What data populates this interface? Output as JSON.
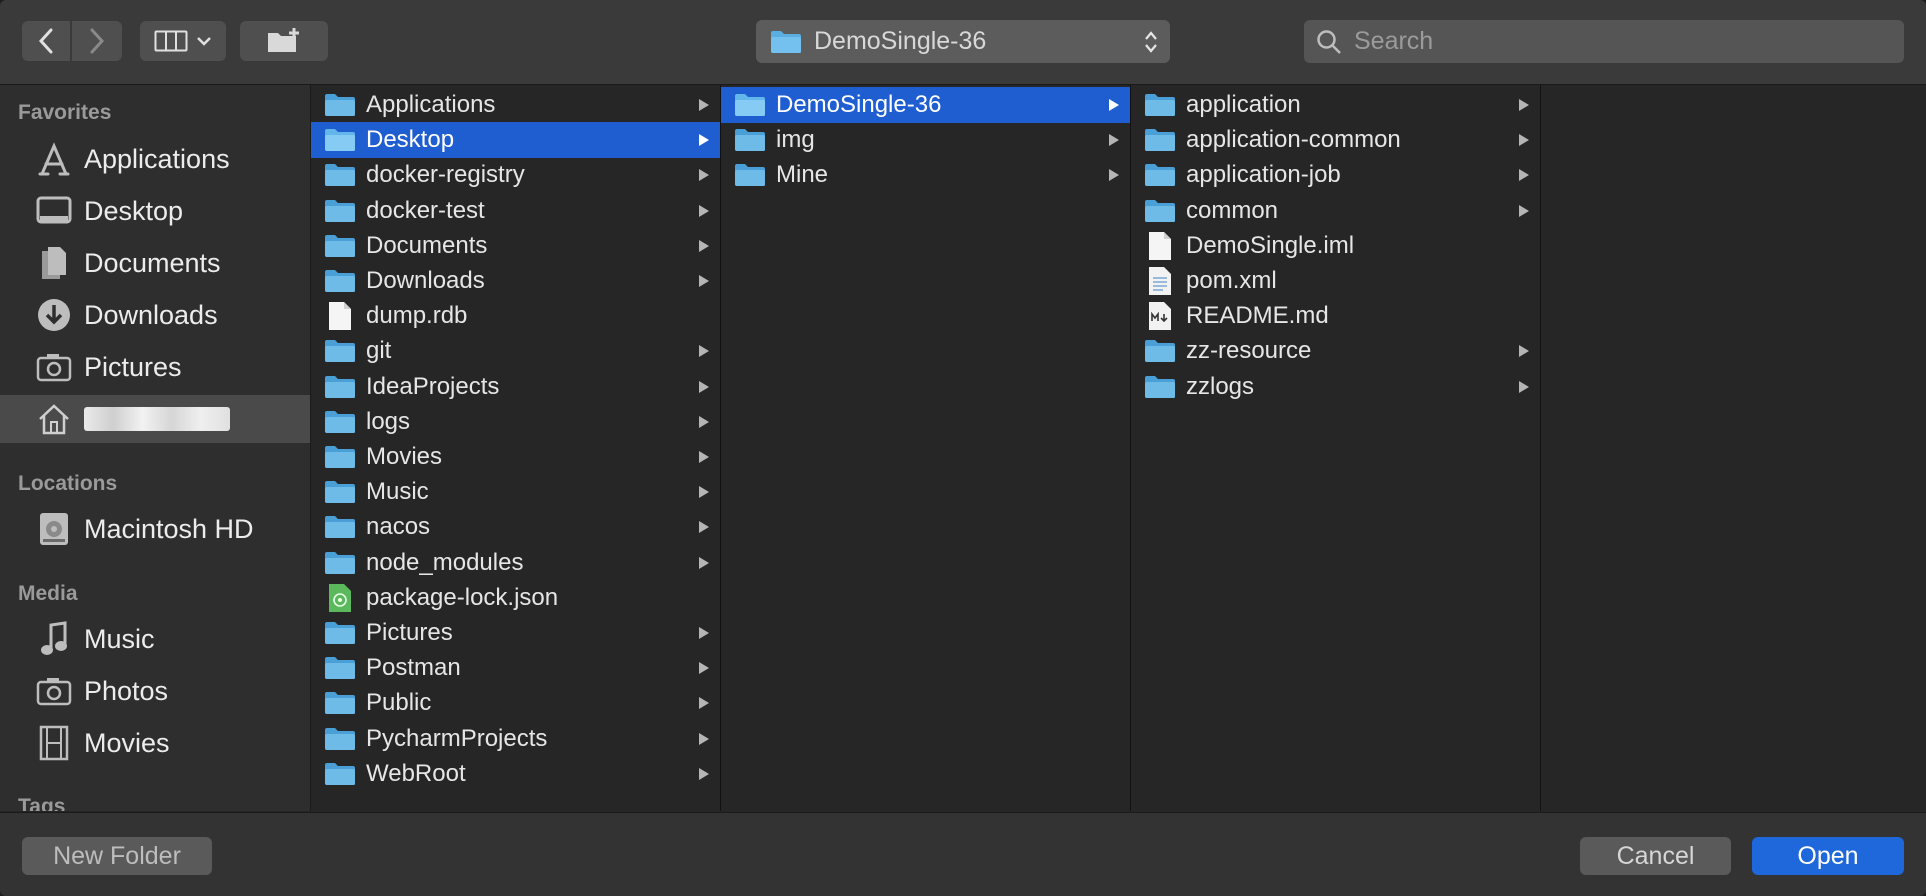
{
  "toolbar": {
    "path_label": "DemoSingle-36",
    "search_placeholder": "Search"
  },
  "sidebar": {
    "favorites_title": "Favorites",
    "favorites": [
      {
        "label": "Applications",
        "icon": "applications-icon"
      },
      {
        "label": "Desktop",
        "icon": "desktop-icon"
      },
      {
        "label": "Documents",
        "icon": "documents-icon"
      },
      {
        "label": "Downloads",
        "icon": "downloads-icon"
      },
      {
        "label": "Pictures",
        "icon": "pictures-icon"
      }
    ],
    "home_icon": "home-icon",
    "locations_title": "Locations",
    "locations": [
      {
        "label": "Macintosh HD",
        "icon": "hard-drive-icon"
      }
    ],
    "media_title": "Media",
    "media": [
      {
        "label": "Music",
        "icon": "music-note-icon"
      },
      {
        "label": "Photos",
        "icon": "camera-icon"
      },
      {
        "label": "Movies",
        "icon": "film-icon"
      }
    ],
    "tags_title": "Tags"
  },
  "column1": {
    "items": [
      {
        "label": "Applications",
        "kind": "folder",
        "arrow": true
      },
      {
        "label": "Desktop",
        "kind": "folder",
        "arrow": true,
        "selected": true
      },
      {
        "label": "docker-registry",
        "kind": "folder",
        "arrow": true
      },
      {
        "label": "docker-test",
        "kind": "folder",
        "arrow": true
      },
      {
        "label": "Documents",
        "kind": "folder",
        "arrow": true
      },
      {
        "label": "Downloads",
        "kind": "folder",
        "arrow": true
      },
      {
        "label": "dump.rdb",
        "kind": "file",
        "arrow": false
      },
      {
        "label": "git",
        "kind": "folder",
        "arrow": true
      },
      {
        "label": "IdeaProjects",
        "kind": "folder",
        "arrow": true
      },
      {
        "label": "logs",
        "kind": "folder",
        "arrow": true
      },
      {
        "label": "Movies",
        "kind": "folder",
        "arrow": true
      },
      {
        "label": "Music",
        "kind": "folder",
        "arrow": true
      },
      {
        "label": "nacos",
        "kind": "folder",
        "arrow": true
      },
      {
        "label": "node_modules",
        "kind": "folder",
        "arrow": true
      },
      {
        "label": "package-lock.json",
        "kind": "json",
        "arrow": false
      },
      {
        "label": "Pictures",
        "kind": "folder",
        "arrow": true
      },
      {
        "label": "Postman",
        "kind": "folder",
        "arrow": true
      },
      {
        "label": "Public",
        "kind": "folder",
        "arrow": true
      },
      {
        "label": "PycharmProjects",
        "kind": "folder",
        "arrow": true
      },
      {
        "label": "WebRoot",
        "kind": "folder",
        "arrow": true
      }
    ]
  },
  "column2": {
    "items": [
      {
        "label": "DemoSingle-36",
        "kind": "folder",
        "arrow": true,
        "selected": true
      },
      {
        "label": "img",
        "kind": "folder",
        "arrow": true
      },
      {
        "label": "Mine",
        "kind": "folder",
        "arrow": true
      }
    ]
  },
  "column3": {
    "items": [
      {
        "label": "application",
        "kind": "folder",
        "arrow": true
      },
      {
        "label": "application-common",
        "kind": "folder",
        "arrow": true
      },
      {
        "label": "application-job",
        "kind": "folder",
        "arrow": true
      },
      {
        "label": "common",
        "kind": "folder",
        "arrow": true
      },
      {
        "label": "DemoSingle.iml",
        "kind": "file",
        "arrow": false
      },
      {
        "label": "pom.xml",
        "kind": "xml",
        "arrow": false
      },
      {
        "label": "README.md",
        "kind": "md",
        "arrow": false
      },
      {
        "label": "zz-resource",
        "kind": "folder",
        "arrow": true
      },
      {
        "label": "zzlogs",
        "kind": "folder",
        "arrow": true
      }
    ]
  },
  "buttons": {
    "new_folder": "New Folder",
    "cancel": "Cancel",
    "open": "Open"
  },
  "colors": {
    "selection": "#1f5ed1",
    "folder": "#5aaee0",
    "open_button": "#1f68db"
  }
}
